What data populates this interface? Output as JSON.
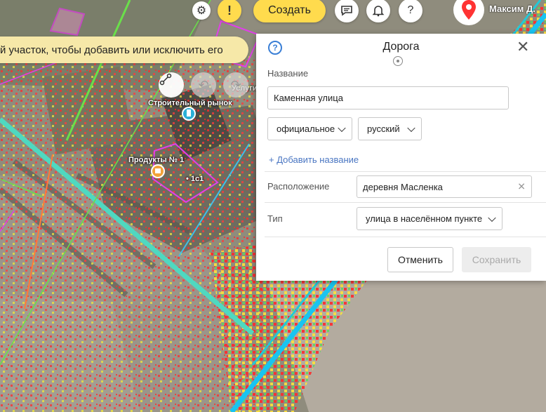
{
  "map": {
    "labels": {
      "market": "Строительный рынок",
      "products": "Продукты № 1",
      "building": "• 1с1",
      "partial": "Услуги"
    }
  },
  "topbar": {
    "create_label": "Создать",
    "user_name": "Максим Д.",
    "alert_glyph": "!",
    "help_glyph": "?"
  },
  "hint": {
    "text": "й участок, чтобы добавить или исключить его"
  },
  "panel": {
    "title": "Дорога",
    "help_glyph": "?",
    "close_glyph": "✕",
    "name_label": "Название",
    "name_value": "Каменная улица",
    "name_type": "официальное",
    "language": "русский",
    "add_name": "+ Добавить название",
    "location_label": "Расположение",
    "location_value": "деревня Масленка",
    "type_label": "Тип",
    "type_value": "улица в населённом пункте",
    "cancel_label": "Отменить",
    "save_label": "Сохранить"
  },
  "colors": {
    "accent_yellow": "#ffdb4d",
    "annotation_red": "#e0141e",
    "road_teal": "#4fd8c0",
    "road_cyan": "#19c4f0",
    "link_blue": "#4a76c2"
  }
}
